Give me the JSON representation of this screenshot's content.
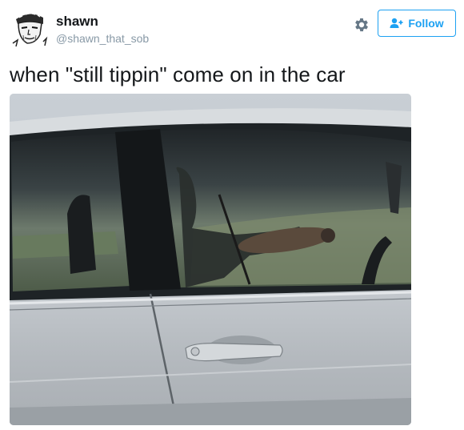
{
  "user": {
    "name": "shawn",
    "handle": "@shawn_that_sob"
  },
  "actions": {
    "follow_label": "Follow",
    "gear_icon": "gear-icon",
    "follow_icon": "add-user-icon"
  },
  "tweet": {
    "text": "when \"still tippin\" come on in the car"
  },
  "colors": {
    "accent": "#1da1f2",
    "secondary_text": "#8899a6",
    "primary_text": "#14171a"
  }
}
